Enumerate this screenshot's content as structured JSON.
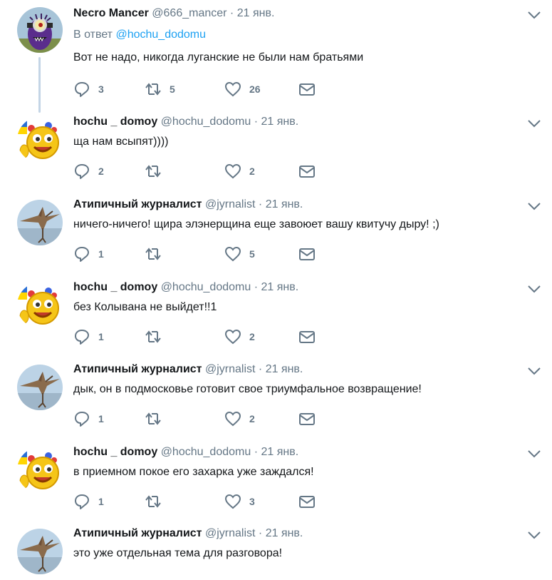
{
  "tweets": [
    {
      "name": "Necro Mancer",
      "handle": "@666_mancer",
      "sep": "·",
      "time": "21 янв.",
      "reply_prefix": "В ответ ",
      "reply_mention": "@hochu_dodomu",
      "text": "Вот не надо, никогда луганские не были нам братьями",
      "replies": "3",
      "retweets": "5",
      "likes": "26",
      "avatar": "minion-avatar"
    },
    {
      "name": "hochu _ domoy",
      "handle": "@hochu_dodomu",
      "sep": "·",
      "time": "21 янв.",
      "text": "ща нам всыпят))))",
      "replies": "2",
      "retweets": "",
      "likes": "2",
      "avatar": "smiley-avatar"
    },
    {
      "name": "Атипичный журналист",
      "handle": "@jyrnalist",
      "sep": "·",
      "time": "21 янв.",
      "text": "ничего-ничего! щира элэнерщина еще завоюет вашу квитучу дыру! ;)",
      "replies": "1",
      "retweets": "",
      "likes": "5",
      "avatar": "pterodactyl-avatar"
    },
    {
      "name": "hochu _ domoy",
      "handle": "@hochu_dodomu",
      "sep": "·",
      "time": "21 янв.",
      "text": "без Колывана не выйдет!!1",
      "replies": "1",
      "retweets": "",
      "likes": "2",
      "avatar": "smiley-avatar"
    },
    {
      "name": "Атипичный журналист",
      "handle": "@jyrnalist",
      "sep": "·",
      "time": "21 янв.",
      "text": "дык, он в подмосковье готовит свое триумфальное возвращение!",
      "replies": "1",
      "retweets": "",
      "likes": "2",
      "avatar": "pterodactyl-avatar"
    },
    {
      "name": "hochu _ domoy",
      "handle": "@hochu_dodomu",
      "sep": "·",
      "time": "21 янв.",
      "text": "в приемном покое его захарка уже заждался!",
      "replies": "1",
      "retweets": "",
      "likes": "3",
      "avatar": "smiley-avatar"
    },
    {
      "name": "Атипичный журналист",
      "handle": "@jyrnalist",
      "sep": "·",
      "time": "21 янв.",
      "text": "это уже отдельная тема для разговора!",
      "replies": "",
      "retweets": "",
      "likes": "",
      "avatar": "pterodactyl-avatar"
    }
  ],
  "colors": {
    "text": "#14171a",
    "secondary": "#657786",
    "link": "#1da1f2",
    "connector": "#c4d5e6"
  }
}
